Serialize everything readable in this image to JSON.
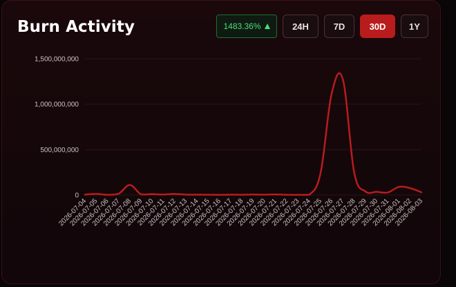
{
  "header": {
    "title": "Burn Activity",
    "change_badge": "1483.36%",
    "ranges": [
      {
        "label": "24H",
        "active": false
      },
      {
        "label": "7D",
        "active": false
      },
      {
        "label": "30D",
        "active": true
      },
      {
        "label": "1Y",
        "active": false
      }
    ]
  },
  "colors": {
    "line": "#b91c1c",
    "positive": "#4ade80",
    "accent": "#b91c1c",
    "grid": "#2a1619"
  },
  "chart_data": {
    "type": "line",
    "x": [
      "2026-07-04",
      "2026-07-05",
      "2026-07-06",
      "2026-07-07",
      "2026-07-08",
      "2026-07-09",
      "2026-07-10",
      "2026-07-11",
      "2026-07-12",
      "2026-07-13",
      "2026-07-14",
      "2026-07-15",
      "2026-07-16",
      "2026-07-17",
      "2026-07-18",
      "2026-07-19",
      "2026-07-20",
      "2026-07-21",
      "2026-07-22",
      "2026-07-23",
      "2026-07-24",
      "2026-07-25",
      "2026-07-26",
      "2026-07-27",
      "2026-07-28",
      "2026-07-29",
      "2026-07-30",
      "2026-07-31",
      "2026-08-01",
      "2026-08-02",
      "2026-08-03"
    ],
    "values": [
      5000000,
      12000000,
      3000000,
      15000000,
      110000000,
      8000000,
      10000000,
      6000000,
      12000000,
      5000000,
      4000000,
      3000000,
      2000000,
      4000000,
      3000000,
      6000000,
      4000000,
      7000000,
      3000000,
      2000000,
      3000000,
      240000000,
      1120000000,
      1270000000,
      250000000,
      40000000,
      35000000,
      28000000,
      90000000,
      75000000,
      30000000
    ],
    "yticks": [
      0,
      500000000,
      1000000000,
      1500000000
    ],
    "ytick_labels": [
      "0",
      "500,000,000",
      "1,000,000,000",
      "1,500,000,000"
    ],
    "ylim": [
      0,
      1500000000
    ],
    "grid": true,
    "legend": "none",
    "title": "",
    "xlabel": "",
    "ylabel": ""
  }
}
